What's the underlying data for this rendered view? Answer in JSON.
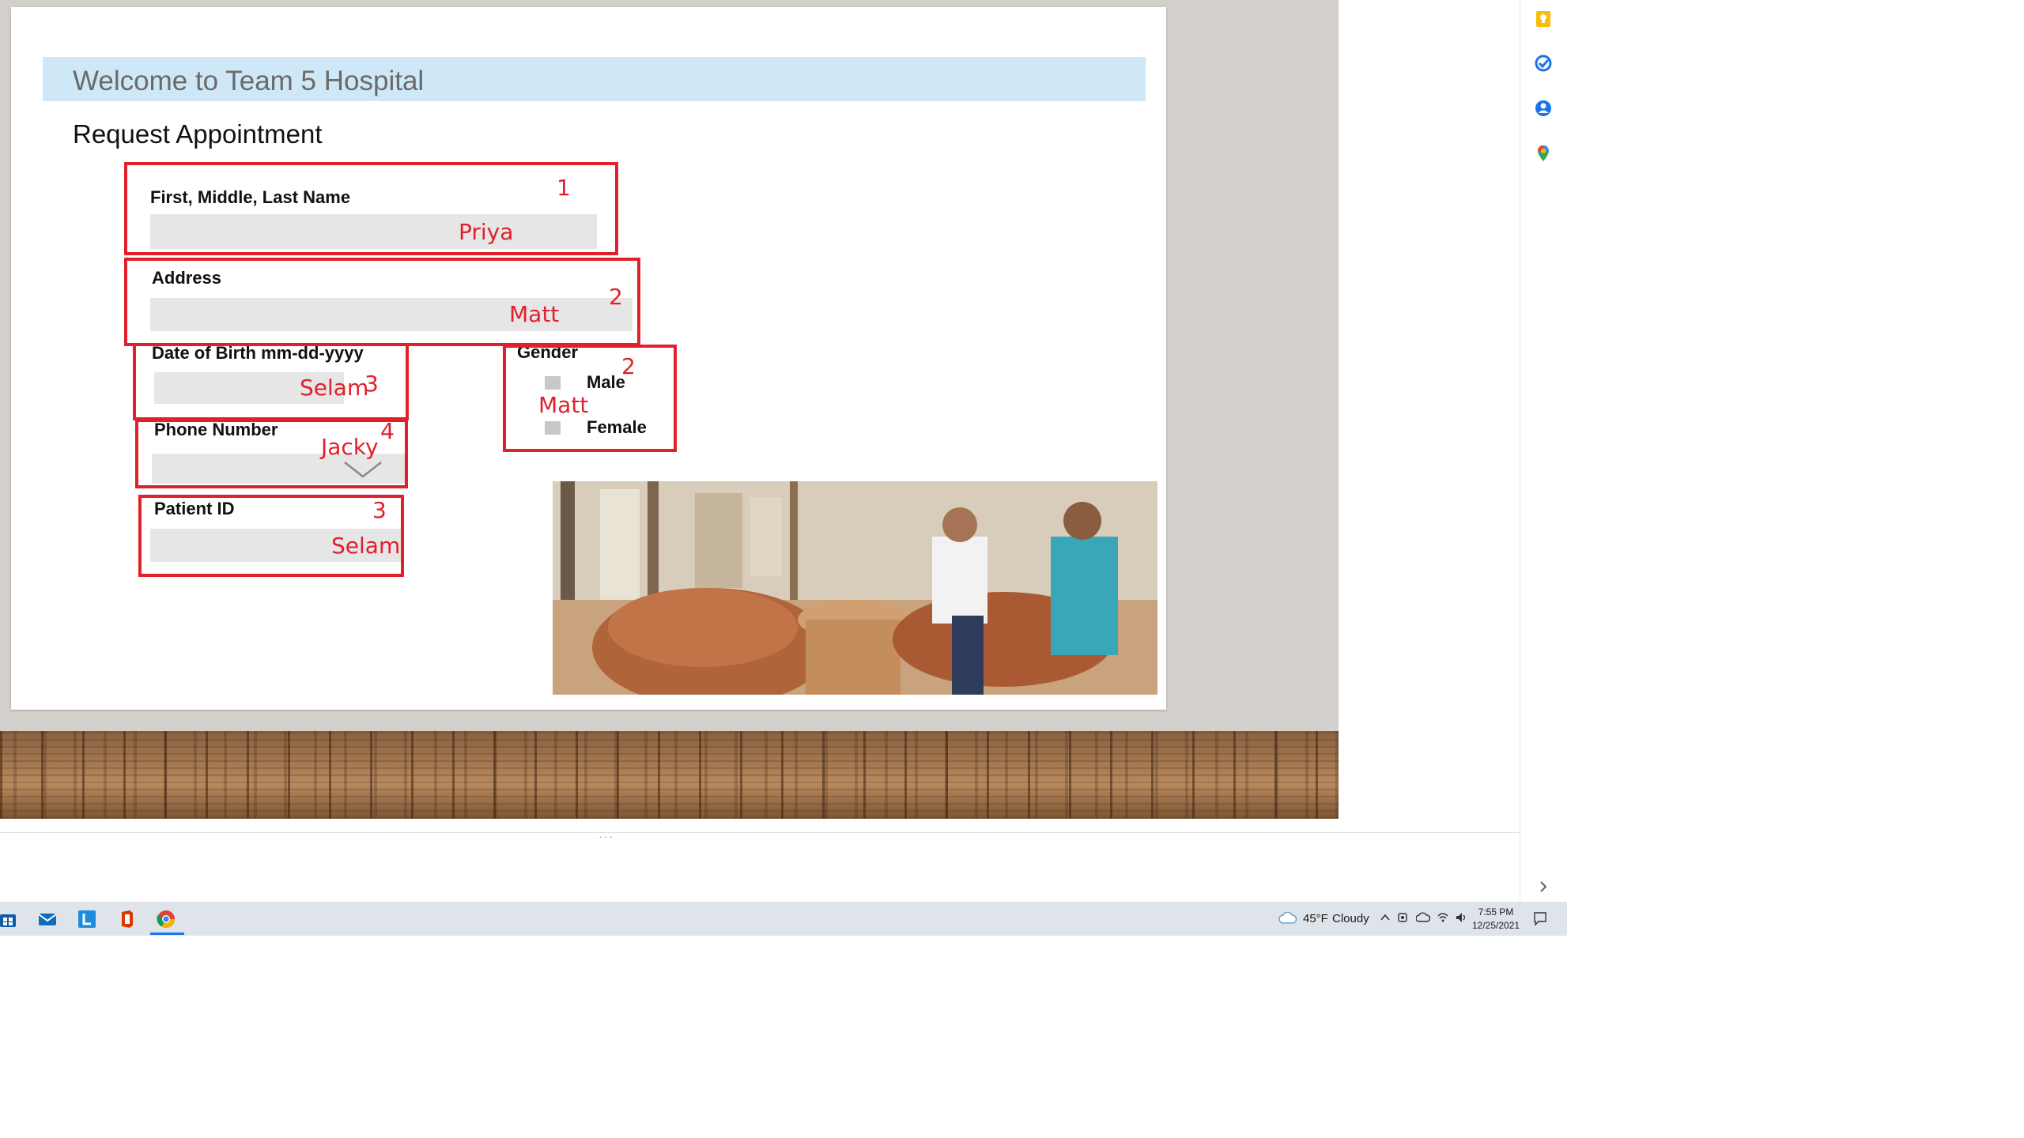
{
  "slide": {
    "banner_title": "Welcome to Team 5 Hospital",
    "subtitle": "Request Appointment",
    "fields": {
      "name_label": "First, Middle, Last Name",
      "address_label": "Address",
      "dob_label": "Date of Birth mm-dd-yyyy",
      "phone_label": "Phone Number",
      "patient_id_label": "Patient ID",
      "gender_label": "Gender",
      "gender_male": "Male",
      "gender_female": "Female"
    },
    "annotations": {
      "name_value": "Priya",
      "name_num": "1",
      "address_value": "Matt",
      "address_num": "2",
      "dob_value": "Selam",
      "dob_num": "3",
      "phone_value": "Jacky",
      "phone_num": "4",
      "patient_id_value": "Selam",
      "patient_id_num": "3",
      "gender_value": "Matt",
      "gender_num": "2"
    },
    "accent_color": "#e0202a",
    "banner_color": "#cfe8f7"
  },
  "sidebar": {
    "icons": [
      "keep-icon",
      "tasks-icon",
      "contacts-icon",
      "maps-icon"
    ],
    "expand_icon": "chevron-right-icon"
  },
  "taskbar": {
    "apps": [
      "windows-store-icon",
      "mail-icon",
      "lync-icon",
      "office-icon",
      "chrome-icon"
    ],
    "weather_temp": "45°F",
    "weather_cond": "Cloudy",
    "time": "7:55 PM",
    "date": "12/25/2021"
  }
}
